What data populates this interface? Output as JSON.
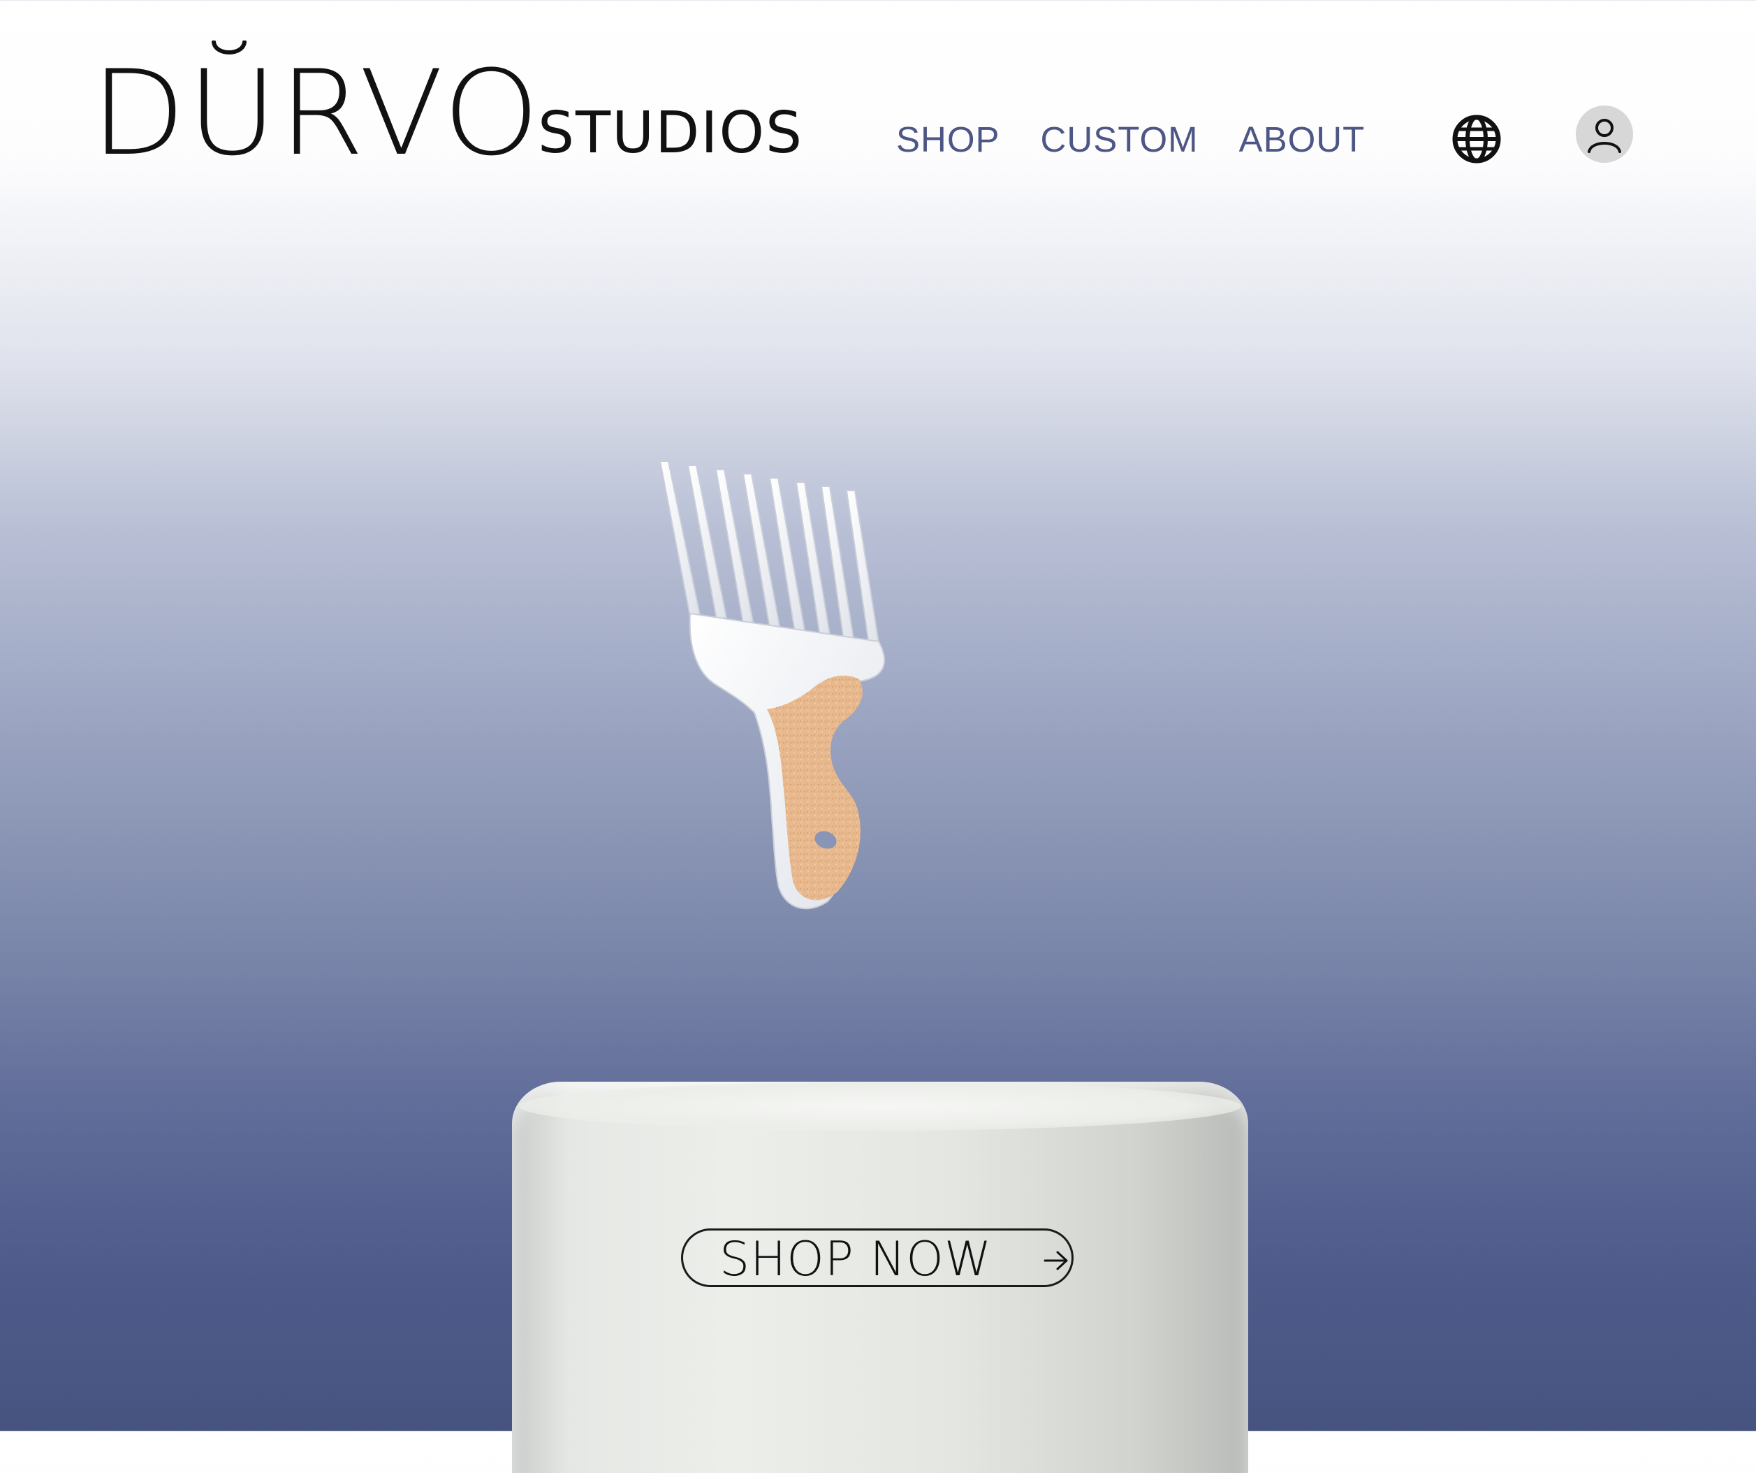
{
  "header": {
    "logo_main": "DURVO",
    "logo_sub": "STUDIOS",
    "nav": [
      {
        "label": "SHOP"
      },
      {
        "label": "CUSTOM"
      },
      {
        "label": "ABOUT"
      }
    ],
    "icons": {
      "language": "globe-icon",
      "account": "user-icon"
    }
  },
  "hero": {
    "product_image": "afro-pick-comb",
    "cta_label": "SHOP NOW",
    "cta_icon": "arrow-right-icon"
  },
  "colors": {
    "nav_text": "#4d5684",
    "gradient_top": "#ffffff",
    "gradient_bottom": "#47537f",
    "podium": "#e6e8e5",
    "comb": "#f1f3f5",
    "cork": "#e8b98e"
  }
}
